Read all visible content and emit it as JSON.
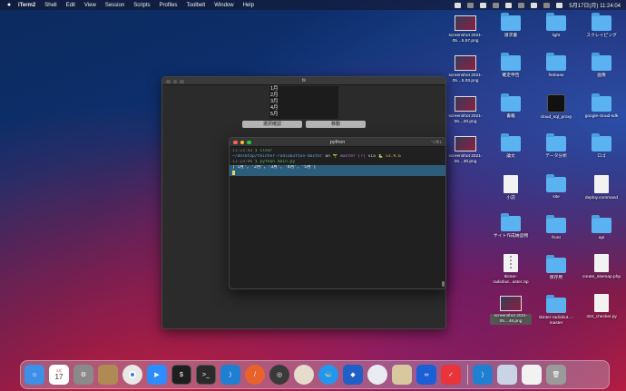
{
  "menubar": {
    "app_name": "iTerm2",
    "items": [
      "Shell",
      "Edit",
      "View",
      "Session",
      "Scripts",
      "Profiles",
      "Toolbelt",
      "Window",
      "Help"
    ],
    "clock": "5月17日(月)  11:24:04"
  },
  "tk_window": {
    "title": "tk",
    "listbox_items": [
      "1月",
      "2月",
      "3月",
      "4月",
      "5月"
    ],
    "button_left": "選択確認",
    "button_right": "移動"
  },
  "terminal": {
    "title": "python",
    "shortcut": "⌥⌘1",
    "lines": {
      "l1_time": "11:23:43",
      "l1_cmd": "❯ clear",
      "l2_path": "~/desktop/tkinter-radiobutton-master",
      "l2_on": " on ",
      "l2_branch": "🌱 master [?]",
      "l2_via": " via ",
      "l2_py": "🐍 v3.9.6",
      "l3_time": "11:23:46",
      "l3_cmd": "❯ python main.py",
      "l4_output": "['1月', '2月', '3月', '4月', '5月']"
    }
  },
  "desktop_icons": {
    "col1": [
      {
        "label": "screenshot 2021-05…5.57.png",
        "kind": "thumb"
      },
      {
        "label": "screenshot 2021-05…5.03.png",
        "kind": "thumb"
      },
      {
        "label": "screenshot 2021-05…20.png",
        "kind": "thumb"
      },
      {
        "label": "screenshot 2021-05…30.png",
        "kind": "thumb"
      }
    ],
    "col2": [
      {
        "label": "請求書",
        "kind": "folder"
      },
      {
        "label": "確定申告",
        "kind": "folder"
      },
      {
        "label": "書籍",
        "kind": "folder"
      },
      {
        "label": "論文",
        "kind": "folder"
      },
      {
        "label": "小説",
        "kind": "doc"
      },
      {
        "label": "サイト作成納品物",
        "kind": "folder"
      },
      {
        "label": "tkinter-radiobut...aster.zip",
        "kind": "zip"
      },
      {
        "label": "screenshot 2021-05…48.png",
        "kind": "thumb"
      }
    ],
    "col3": [
      {
        "label": "light",
        "kind": "folder"
      },
      {
        "label": "firebase",
        "kind": "folder"
      },
      {
        "label": "cloud_sql_proxy",
        "kind": "app"
      },
      {
        "label": "データ分析",
        "kind": "folder"
      },
      {
        "label": "site",
        "kind": "folder"
      },
      {
        "label": "front",
        "kind": "folder"
      },
      {
        "label": "保存用",
        "kind": "folder"
      },
      {
        "label": "tkinter-radiobut...-master",
        "kind": "folder"
      }
    ],
    "col4": [
      {
        "label": "スクレイピング",
        "kind": "folder"
      },
      {
        "label": "画像",
        "kind": "folder"
      },
      {
        "label": "google-cloud-sdk",
        "kind": "folder"
      },
      {
        "label": "ロゴ",
        "kind": "folder"
      },
      {
        "label": "deploy.command",
        "kind": "doc"
      },
      {
        "label": "api",
        "kind": "folder"
      },
      {
        "label": "create_sitemap.php",
        "kind": "doc"
      },
      {
        "label": "404_checker.py",
        "kind": "doc"
      }
    ]
  },
  "dock": {
    "calendar_month": "5月",
    "calendar_day": "17",
    "apps": [
      {
        "name": "finder",
        "color": "#3d8fe8"
      },
      {
        "name": "calendar",
        "color": "#ffffff"
      },
      {
        "name": "system-preferences",
        "color": "#8a8a8a"
      },
      {
        "name": "contacts",
        "color": "#b08a55"
      },
      {
        "name": "chrome",
        "color": "#e8e8e8"
      },
      {
        "name": "zoom",
        "color": "#2d8cff"
      },
      {
        "name": "iterm",
        "color": "#1e1e1e"
      },
      {
        "name": "terminal",
        "color": "#2a2a2a"
      },
      {
        "name": "vscode",
        "color": "#1f7fd0"
      },
      {
        "name": "transmit",
        "color": "#e8632b"
      },
      {
        "name": "quicktime",
        "color": "#3a3a3a"
      },
      {
        "name": "sequel",
        "color": "#e5dccb"
      },
      {
        "name": "docker",
        "color": "#2396ed"
      },
      {
        "name": "sourcetree",
        "color": "#1e5fc8"
      },
      {
        "name": "keynote",
        "color": "#e9ecf2"
      },
      {
        "name": "preview",
        "color": "#d8c8a0"
      },
      {
        "name": "infinity",
        "color": "#1a5fd6"
      },
      {
        "name": "tasks",
        "color": "#e8343a"
      }
    ],
    "recent": [
      {
        "name": "vscode-recent",
        "color": "#1f7fd0"
      },
      {
        "name": "image-file",
        "color": "#c9d4e6"
      },
      {
        "name": "document-file",
        "color": "#f2f2f2"
      },
      {
        "name": "trash",
        "color": "#9a9a9a"
      }
    ]
  }
}
